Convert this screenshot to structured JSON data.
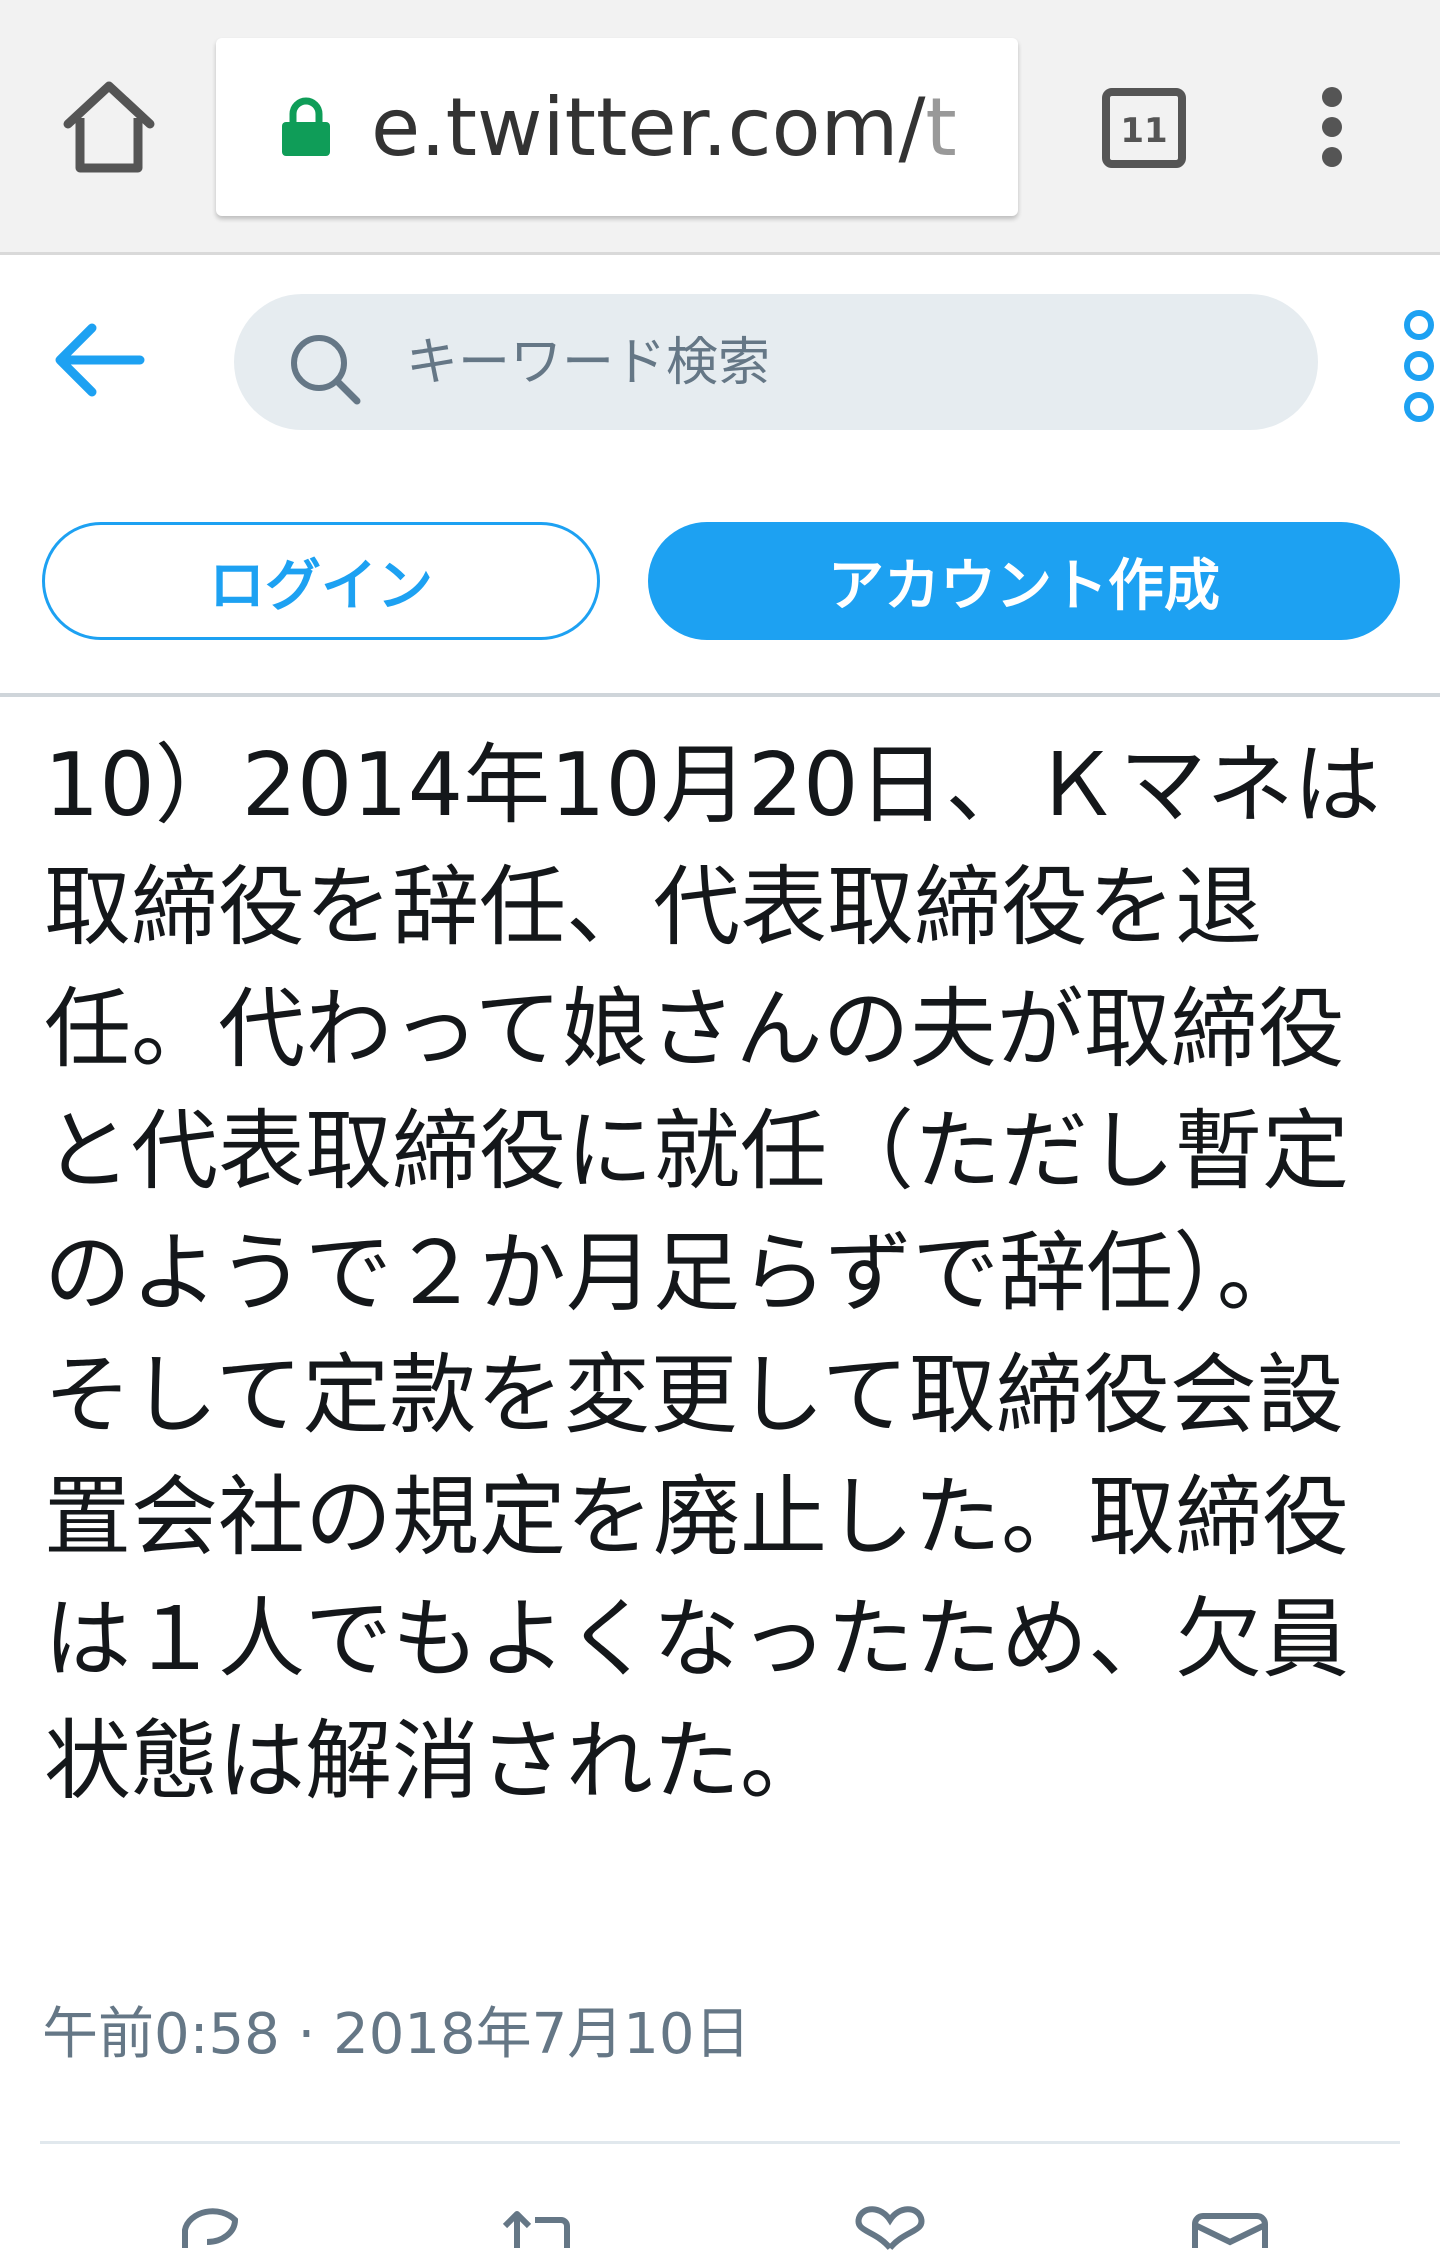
{
  "browser": {
    "url_main": "e.twitter.com/",
    "url_faded": "t",
    "tab_count": "11",
    "icons": {
      "home": "home-icon",
      "lock": "lock-icon",
      "tabs": "tab-switcher-icon",
      "menu": "overflow-menu-icon"
    },
    "colors": {
      "lock": "#0f9d58",
      "chrome_bg": "#f2f2f2"
    }
  },
  "header": {
    "search_placeholder": "キーワード検索",
    "icons": {
      "back": "back-arrow-icon",
      "search": "search-icon",
      "more": "more-vertical-icon"
    },
    "accent": "#1da1f2"
  },
  "auth": {
    "login_label": "ログイン",
    "signup_label": "アカウント作成"
  },
  "tweet": {
    "text": "10）2014年10月20日、Ｋマネは取締役を辞任、代表取締役を退任。代わって娘さんの夫が取締役と代表取締役に就任（ただし暫定のようで２か月足らずで辞任）。\nそして定款を変更して取締役会設置会社の規定を廃止した。取締役は１人でもよくなったため、欠員状態は解消された。",
    "timestamp": "午前0:58 · 2018年7月10日",
    "actions": [
      "reply-icon",
      "retweet-icon",
      "like-icon",
      "share-icon"
    ]
  }
}
